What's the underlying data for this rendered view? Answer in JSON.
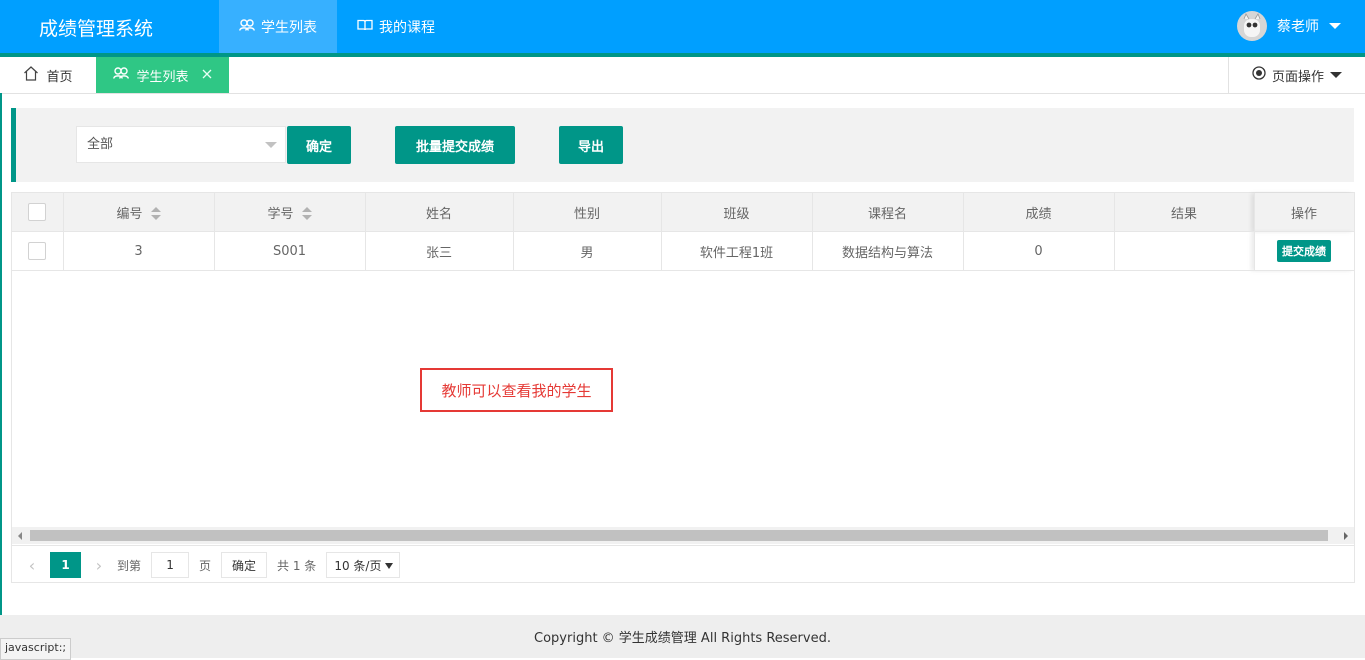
{
  "header": {
    "app_title": "成绩管理系统",
    "nav": [
      {
        "label": "学生列表",
        "icon": "users-icon"
      },
      {
        "label": "我的课程",
        "icon": "book-icon"
      }
    ],
    "user_name": "蔡老师"
  },
  "tabs": {
    "home": "首页",
    "students": "学生列表",
    "page_ops": "页面操作"
  },
  "toolbar": {
    "filter_value": "全部",
    "confirm_label": "确定",
    "batch_submit_label": "批量提交成绩",
    "export_label": "导出"
  },
  "table": {
    "columns": [
      "编号",
      "学号",
      "姓名",
      "性别",
      "班级",
      "课程名",
      "成绩",
      "结果",
      "操作"
    ],
    "rows": [
      {
        "id": "3",
        "student_no": "S001",
        "name": "张三",
        "gender": "男",
        "class": "软件工程1班",
        "course": "数据结构与算法",
        "score": "0",
        "result": "",
        "action": "提交成绩"
      }
    ]
  },
  "annotation": "教师可以查看我的学生",
  "pager": {
    "prev": "‹",
    "current": "1",
    "next": "›",
    "goto_label": "到第",
    "goto_value": "1",
    "page_unit": "页",
    "confirm": "确定",
    "total": "共 1 条",
    "page_size": "10 条/页"
  },
  "footer": "Copyright © 学生成绩管理 All Rights Reserved.",
  "status_bar": "javascript:;",
  "colors": {
    "header": "#009fff",
    "primary": "#009688",
    "tab_active": "#2fc785",
    "annotation": "#e53935"
  }
}
